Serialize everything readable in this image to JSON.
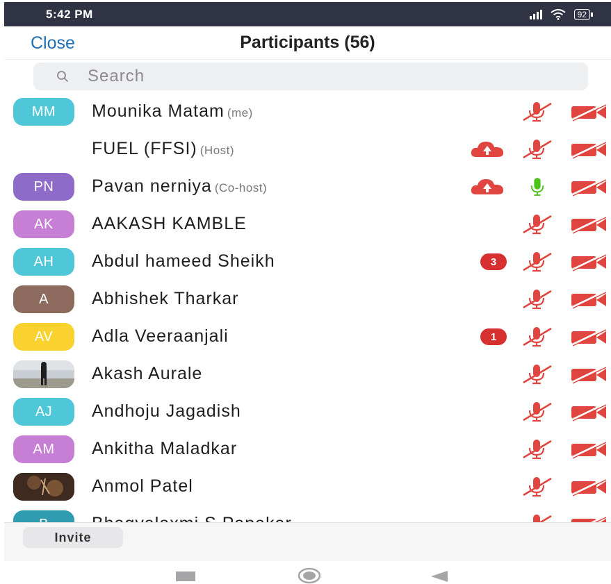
{
  "status_bar": {
    "time": "5:42 PM",
    "battery": "92"
  },
  "header": {
    "close_label": "Close",
    "title": "Participants (56)"
  },
  "search": {
    "placeholder": "Search"
  },
  "participants": [
    {
      "initials": "MM",
      "name": "Mounika Matam",
      "role": "(me)",
      "avatar_color": "#4fc7d8",
      "mic": "muted",
      "camera": "off"
    },
    {
      "initials": "",
      "name": "FUEL (FFSI)",
      "role": "(Host)",
      "avatar_color": "#ffffff",
      "cloud": true,
      "mic": "muted",
      "camera": "off"
    },
    {
      "initials": "PN",
      "name": "Pavan nerniya",
      "role": "(Co-host)",
      "avatar_color": "#8f6bc9",
      "cloud": true,
      "mic": "on",
      "camera": "off"
    },
    {
      "initials": "AK",
      "name": "AAKASH KAMBLE",
      "role": "",
      "avatar_color": "#c67fd4",
      "mic": "muted",
      "camera": "off"
    },
    {
      "initials": "AH",
      "name": "Abdul hameed Sheikh",
      "role": "",
      "avatar_color": "#4fc7d8",
      "badge": "3",
      "mic": "muted",
      "camera": "off"
    },
    {
      "initials": "A",
      "name": "Abhishek Tharkar",
      "role": "",
      "avatar_color": "#8d6a5e",
      "mic": "muted",
      "camera": "off"
    },
    {
      "initials": "AV",
      "name": "Adla Veeraanjali",
      "role": "",
      "avatar_color": "#f9d230",
      "badge": "1",
      "mic": "muted",
      "camera": "off"
    },
    {
      "initials": "",
      "name": "Akash Aurale",
      "role": "",
      "avatar_color": "#b0b7bb",
      "photo": "outdoor",
      "mic": "muted",
      "camera": "off"
    },
    {
      "initials": "AJ",
      "name": "Andhoju Jagadish",
      "role": "",
      "avatar_color": "#4fc7d8",
      "mic": "muted",
      "camera": "off"
    },
    {
      "initials": "AM",
      "name": "Ankitha Maladkar",
      "role": "",
      "avatar_color": "#c67fd4",
      "mic": "muted",
      "camera": "off"
    },
    {
      "initials": "",
      "name": "Anmol Patel",
      "role": "",
      "avatar_color": "#5b3d2c",
      "photo": "dark",
      "mic": "muted",
      "camera": "off"
    },
    {
      "initials": "B",
      "name": "Bhagyalaxmi S Papakar",
      "role": "",
      "avatar_color": "#2f9cb0",
      "mic": "muted",
      "camera": "off"
    }
  ],
  "footer": {
    "invite_label": "Invite"
  },
  "colors": {
    "accent": "#1f6fb5",
    "muted_red": "#e0453f",
    "mic_on_green": "#4cc319",
    "badge_red": "#d63031"
  },
  "icons": {
    "mic_muted": "mic-muted-icon",
    "mic_on": "mic-icon",
    "camera_off": "video-off-icon",
    "cloud": "cloud-icon",
    "search": "search-icon"
  }
}
